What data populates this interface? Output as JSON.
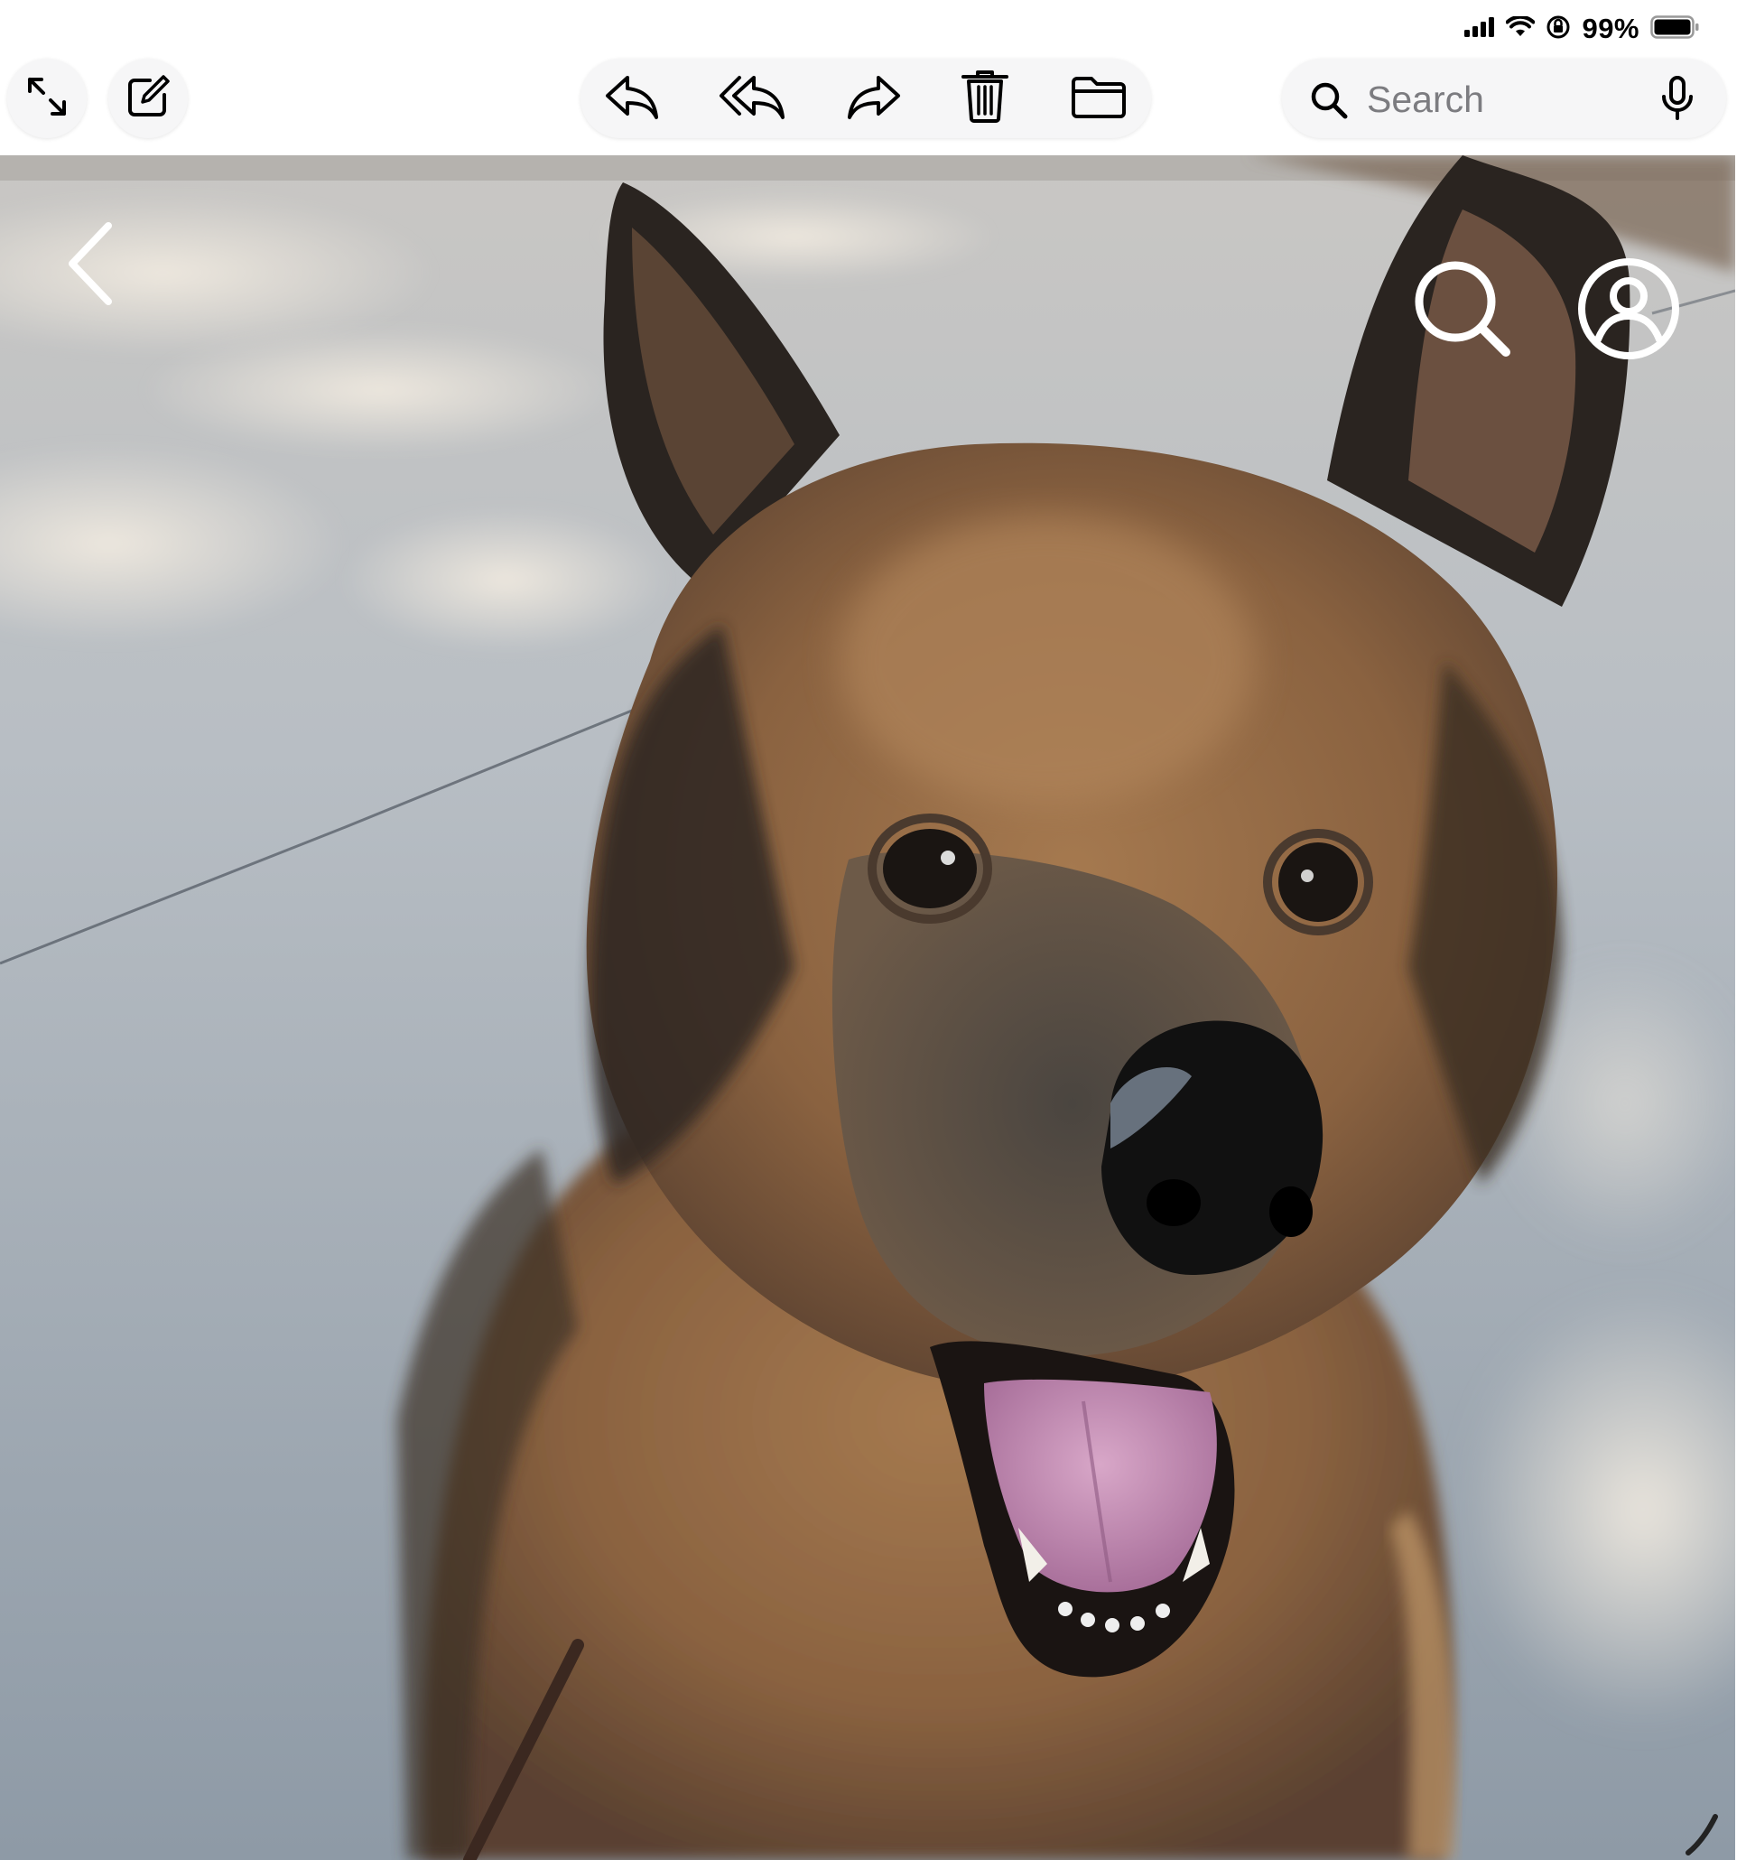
{
  "status_bar": {
    "battery_percent_text": "99%",
    "battery_level": 0.99,
    "icons": [
      "cellular-signal-icon",
      "wifi-icon",
      "orientation-lock-icon",
      "battery-icon"
    ]
  },
  "toolbar": {
    "left_buttons": [
      "expand-icon",
      "compose-icon"
    ],
    "actions": [
      "reply-icon",
      "reply-all-icon",
      "forward-icon",
      "trash-icon",
      "folder-icon"
    ],
    "search": {
      "placeholder": "Search",
      "value": "",
      "icons": [
        "search-icon",
        "microphone-icon"
      ]
    }
  },
  "viewer": {
    "image_subject": "dog",
    "overlay_buttons": [
      "back-chevron-icon",
      "zoom-search-icon",
      "profile-icon"
    ]
  },
  "colors": {
    "toolbar_bg": "#ffffff",
    "button_bg": "#f6f6f7",
    "icon": "#000000",
    "overlay_icon": "#ffffff"
  }
}
